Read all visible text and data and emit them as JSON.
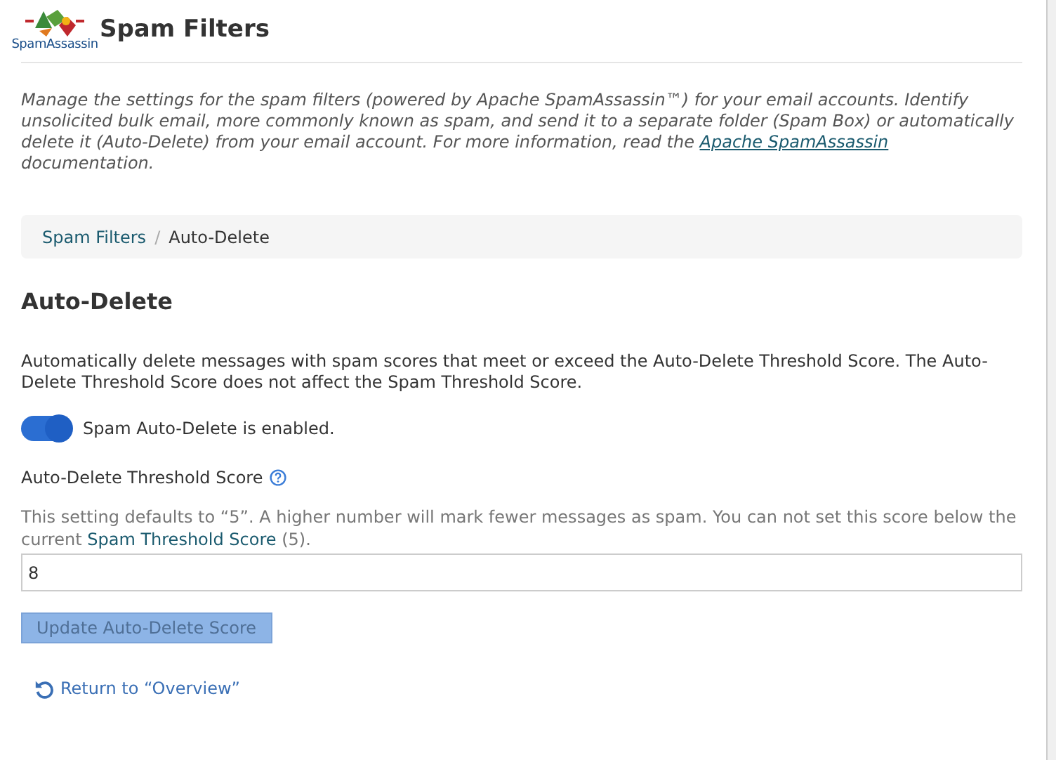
{
  "header": {
    "logo_text": "SpamAssassin",
    "title": "Spam Filters"
  },
  "intro": {
    "before": "Manage the settings for the spam filters (powered by Apache SpamAssassin™) for your email accounts. Identify unsolicited bulk email, more commonly known as spam, and send it to a separate folder (Spam Box) or automatically delete it (Auto-Delete) from your email account. For more information, read the ",
    "link": "Apache SpamAssassin",
    "after": " documentation."
  },
  "breadcrumb_separator": "/",
  "breadcrumb": [
    {
      "label": "Spam Filters",
      "kind": "link"
    },
    {
      "label": "Auto-Delete",
      "kind": "current"
    }
  ],
  "section_title": "Auto-Delete",
  "description": "Automatically delete messages with spam scores that meet or exceed the Auto-Delete Threshold Score. The Auto-Delete Threshold Score does not affect the Spam Threshold Score.",
  "toggle": {
    "on": true,
    "label": "Spam Auto-Delete is enabled."
  },
  "threshold": {
    "label": "Auto-Delete Threshold Score",
    "help_before": "This setting defaults to “5”. A higher number will mark fewer messages as spam. You can not set this score below the current ",
    "help_link": "Spam Threshold Score",
    "help_after": " (5).",
    "value": "8"
  },
  "submit": {
    "label": "Update Auto-Delete Score",
    "disabled": true
  },
  "return_link": "Return to “Overview”"
}
